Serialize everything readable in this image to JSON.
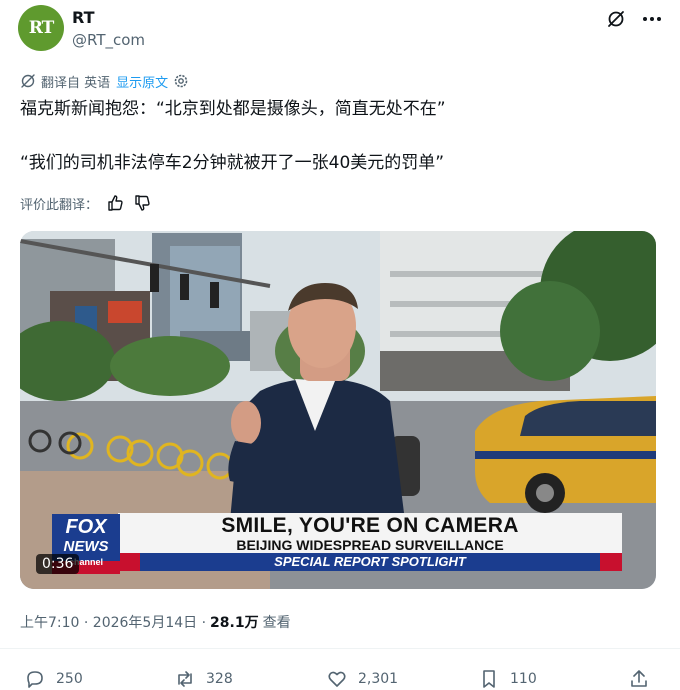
{
  "author": {
    "avatar_text": "RT",
    "name": "RT",
    "handle": "@RT_com"
  },
  "translation": {
    "translated_from": "翻译自 英语",
    "show_original": "显示原文"
  },
  "tweet": {
    "line1": "福克斯新闻抱怨：“北京到处都是摄像头，简直无处不在”",
    "line2": "“我们的司机非法停车2分钟就被开了一张40美元的罚单”"
  },
  "rate_translation": {
    "label": "评价此翻译："
  },
  "media": {
    "duration": "0:36",
    "fox_logo_line1": "FOX",
    "fox_logo_line2": "NEWS",
    "fox_logo_line3": "channel",
    "headline": "SMILE, YOU'RE ON CAMERA",
    "subheadline": "BEIJING WIDESPREAD SURVEILLANCE",
    "banner": "SPECIAL REPORT SPOTLIGHT"
  },
  "meta": {
    "timestamp": "上午7:10 · 2026年5月14日 ·",
    "views_count": "28.1万",
    "views_label": "查看"
  },
  "actions": {
    "replies": "250",
    "reposts": "328",
    "likes": "2,301",
    "bookmarks": "110"
  },
  "colors": {
    "accent": "#1d9bf0",
    "secondary_text": "#536471",
    "fox_blue": "#1b3d8f",
    "fox_red": "#c8102e"
  }
}
